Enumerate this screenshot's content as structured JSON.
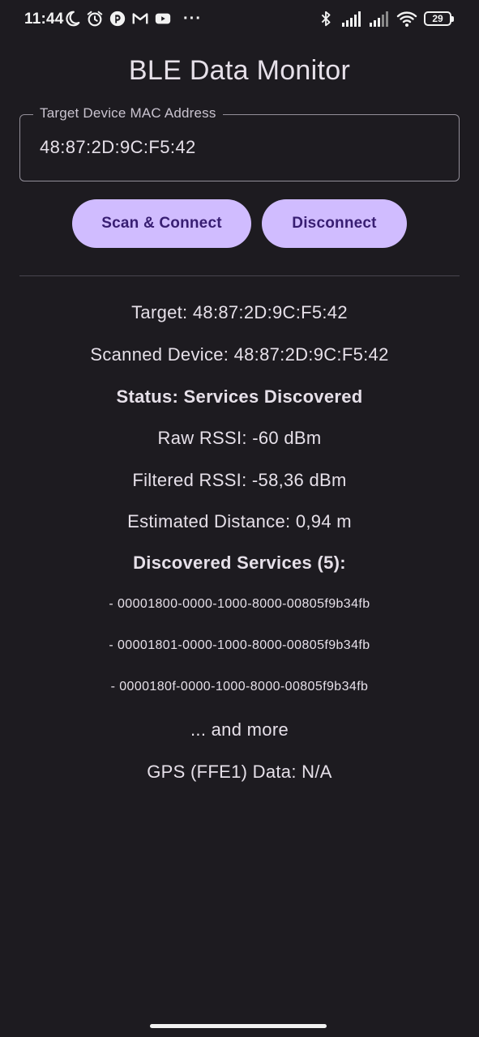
{
  "status_bar": {
    "time": "11:44",
    "battery_level": "29",
    "overflow_dots": "···",
    "icons_left": [
      "moon-icon",
      "alarm-icon",
      "app-icon",
      "gmail-icon",
      "youtube-icon"
    ],
    "icons_right": [
      "bluetooth-icon",
      "signal-icon",
      "signal-icon",
      "wifi-icon",
      "battery-icon"
    ]
  },
  "header": {
    "title": "BLE Data Monitor"
  },
  "mac_field": {
    "label": "Target Device MAC Address",
    "value": "48:87:2D:9C:F5:42"
  },
  "actions": {
    "scan_label": "Scan & Connect",
    "disconnect_label": "Disconnect"
  },
  "info": {
    "target": "Target: 48:87:2D:9C:F5:42",
    "scanned": "Scanned Device: 48:87:2D:9C:F5:42",
    "status": "Status: Services Discovered",
    "raw_rssi": "Raw RSSI: -60 dBm",
    "filtered_rssi": "Filtered RSSI: -58,36 dBm",
    "distance": "Estimated Distance: 0,94 m",
    "services_heading": "Discovered Services (5):",
    "services": [
      "- 00001800-0000-1000-8000-00805f9b34fb",
      "- 00001801-0000-1000-8000-00805f9b34fb",
      "- 0000180f-0000-1000-8000-00805f9b34fb"
    ],
    "more": "... and more",
    "gps": "GPS (FFE1) Data: N/A"
  },
  "colors": {
    "background": "#1d1b20",
    "button": "#d0bcff",
    "button_text": "#381e72",
    "text": "#e6e0e9",
    "outline": "#938f99"
  }
}
